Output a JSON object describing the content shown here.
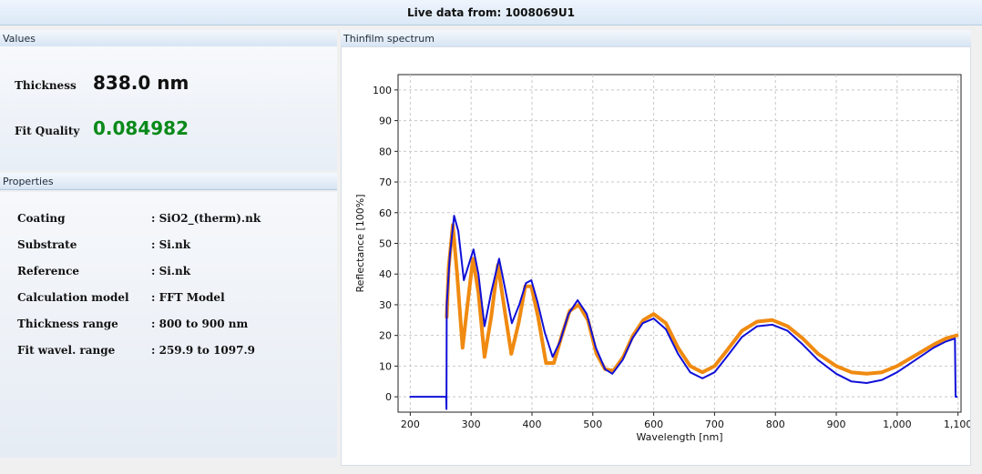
{
  "header": {
    "title": "Live data from: 1008069U1"
  },
  "values_panel": {
    "title": "Values",
    "thickness_label": "Thickness",
    "thickness_value": "838.0 nm",
    "fit_label": "Fit Quality",
    "fit_value": "0.084982"
  },
  "properties_panel": {
    "title": "Properties",
    "rows": [
      {
        "key": "Coating",
        "value": ": SiO2_(therm).nk"
      },
      {
        "key": "Substrate",
        "value": ": Si.nk"
      },
      {
        "key": "Reference",
        "value": ": Si.nk"
      },
      {
        "key": "Calculation model",
        "value": ": FFT Model"
      },
      {
        "key": "Thickness range",
        "value": ": 800 to 900 nm"
      },
      {
        "key": "Fit wavel. range",
        "value": ": 259.9 to 1097.9"
      }
    ]
  },
  "chart_panel": {
    "title": "Thinfilm spectrum"
  },
  "colors": {
    "measured": "#1010d8",
    "fit": "#f08a10",
    "fit_quality": "#0a8a1a"
  },
  "chart_data": {
    "type": "line",
    "xlabel": "Wavelength [nm]",
    "ylabel": "Reflectance [100%]",
    "xlim": [
      180,
      1105
    ],
    "ylim": [
      -5,
      105
    ],
    "x_ticks": [
      200,
      300,
      400,
      500,
      600,
      700,
      800,
      900,
      1000,
      1100
    ],
    "x_tick_labels": [
      "200",
      "300",
      "400",
      "500",
      "600",
      "700",
      "800",
      "900",
      "1,000",
      "1,100"
    ],
    "y_ticks": [
      0,
      10,
      20,
      30,
      40,
      50,
      60,
      70,
      80,
      90,
      100
    ],
    "y_tick_labels": [
      "0",
      "10",
      "20",
      "30",
      "40",
      "50",
      "60",
      "70",
      "80",
      "90",
      "100"
    ],
    "grid": true,
    "series": [
      {
        "color": "#1010d8",
        "x": [
          200,
          259,
          259.5,
          260,
          265,
          272,
          279,
          288,
          296,
          304,
          312,
          322,
          333,
          346,
          357,
          367,
          379,
          390,
          399,
          409,
          421,
          434,
          446,
          460,
          475,
          490,
          505,
          520,
          532,
          549,
          565,
          582,
          600,
          620,
          640,
          660,
          680,
          700,
          720,
          745,
          770,
          795,
          820,
          845,
          870,
          900,
          925,
          950,
          975,
          1000,
          1030,
          1060,
          1080,
          1095,
          1096,
          1098
        ],
        "y": [
          0,
          0,
          -4,
          30,
          46,
          59,
          54,
          38,
          43,
          48,
          40,
          23,
          34,
          45,
          34,
          24,
          30,
          37,
          38,
          31,
          21,
          13,
          18,
          27,
          31.5,
          27,
          16,
          9,
          7.5,
          12,
          19,
          24,
          25.5,
          22,
          14,
          8,
          6,
          8,
          13,
          19.5,
          23,
          23.5,
          21.5,
          17,
          12,
          7.5,
          5,
          4.5,
          5.5,
          8,
          12,
          16,
          18,
          19,
          0,
          0
        ]
      },
      {
        "color": "#f08a10",
        "x": [
          259.9,
          263,
          270,
          277,
          286,
          294,
          303,
          312,
          322,
          333,
          344,
          356,
          366,
          378,
          389,
          399,
          410,
          423,
          436,
          449,
          462,
          477,
          492,
          506,
          520,
          534,
          550,
          566,
          583,
          600,
          620,
          640,
          660,
          680,
          700,
          720,
          745,
          770,
          795,
          820,
          845,
          870,
          900,
          925,
          950,
          975,
          1000,
          1030,
          1060,
          1080,
          1097.9
        ],
        "y": [
          26,
          42,
          56,
          40,
          16,
          30,
          45,
          34,
          13,
          26,
          43,
          27,
          14,
          24,
          36,
          36,
          26,
          11,
          11,
          20,
          28,
          30,
          25,
          14,
          9,
          8.5,
          13,
          20,
          25,
          27,
          24,
          16,
          10,
          8,
          10,
          15,
          21.5,
          24.5,
          25,
          23,
          19,
          14,
          10,
          8,
          7.5,
          8,
          10,
          13.5,
          17,
          19,
          20
        ]
      }
    ]
  }
}
